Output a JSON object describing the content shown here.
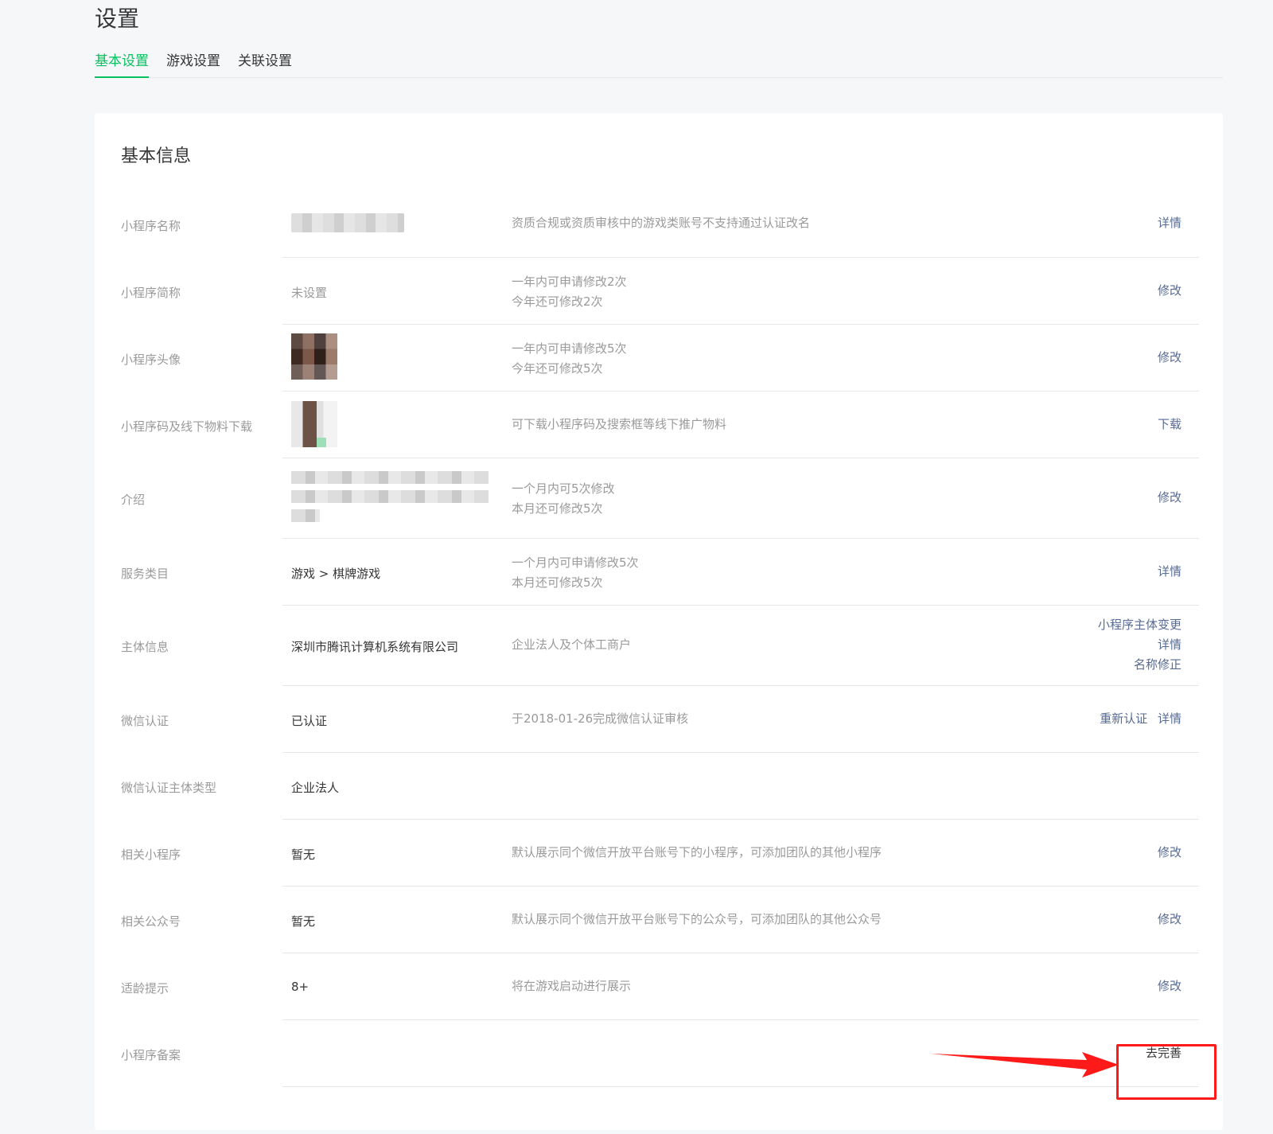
{
  "page": {
    "title": "设置"
  },
  "tabs": [
    {
      "label": "基本设置",
      "active": true
    },
    {
      "label": "游戏设置",
      "active": false
    },
    {
      "label": "关联设置",
      "active": false
    }
  ],
  "section": {
    "title": "基本信息"
  },
  "rows": [
    {
      "label": "小程序名称",
      "value_type": "blurred-text",
      "desc": [
        "资质合规或资质审核中的游戏类账号不支持通过认证改名"
      ],
      "actions": [
        "详情"
      ]
    },
    {
      "label": "小程序简称",
      "value": "未设置",
      "desc": [
        "一年内可申请修改2次",
        "今年还可修改2次"
      ],
      "actions": [
        "修改"
      ]
    },
    {
      "label": "小程序头像",
      "value_type": "blurred-avatar",
      "desc": [
        "一年内可申请修改5次",
        "今年还可修改5次"
      ],
      "actions": [
        "修改"
      ]
    },
    {
      "label": "小程序码及线下物料下载",
      "value_type": "blurred-qrcode",
      "desc": [
        "可下载小程序码及搜索框等线下推广物料"
      ],
      "actions": [
        "下载"
      ]
    },
    {
      "label": "介绍",
      "value_type": "blurred-paragraph",
      "desc": [
        "一个月内可5次修改",
        "本月还可修改5次"
      ],
      "actions": [
        "修改"
      ]
    },
    {
      "label": "服务类目",
      "value": "游戏 > 棋牌游戏",
      "desc": [
        "一个月内可申请修改5次",
        "本月还可修改5次"
      ],
      "actions": [
        "详情"
      ]
    },
    {
      "label": "主体信息",
      "value": "深圳市腾讯计算机系统有限公司",
      "desc": [
        "企业法人及个体工商户"
      ],
      "actions": [
        "小程序主体变更",
        "详情",
        "名称修正"
      ]
    },
    {
      "label": "微信认证",
      "value": "已认证",
      "desc": [
        "于2018-01-26完成微信认证审核"
      ],
      "actions": [
        "重新认证",
        "详情"
      ]
    },
    {
      "label": "微信认证主体类型",
      "value": "企业法人",
      "desc": [],
      "actions": []
    },
    {
      "label": "相关小程序",
      "value": "暂无",
      "desc": [
        "默认展示同个微信开放平台账号下的小程序，可添加团队的其他小程序"
      ],
      "actions": [
        "修改"
      ]
    },
    {
      "label": "相关公众号",
      "value": "暂无",
      "desc": [
        "默认展示同个微信开放平台账号下的公众号，可添加团队的其他公众号"
      ],
      "actions": [
        "修改"
      ]
    },
    {
      "label": "适龄提示",
      "value": "8+",
      "desc": [
        "将在游戏启动进行展示"
      ],
      "actions": [
        "修改"
      ]
    },
    {
      "label": "小程序备案",
      "value": "",
      "desc": [],
      "actions": [
        "去完善"
      ]
    }
  ],
  "colors": {
    "accent_green": "#07c160",
    "link_blue": "#576b95",
    "annotation_red": "#ff1a1a"
  }
}
